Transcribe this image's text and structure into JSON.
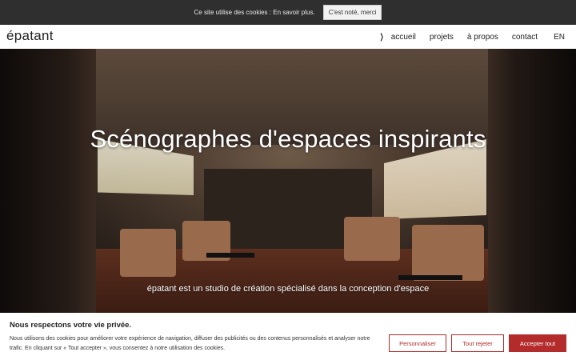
{
  "cookie_bar": {
    "text": "Ce site utilise des cookies : En savoir plus.",
    "button": "C'est noté, merci"
  },
  "header": {
    "logo": "épatant",
    "nav": [
      {
        "label": "accueil",
        "active": true
      },
      {
        "label": "projets"
      },
      {
        "label": "à propos"
      },
      {
        "label": "contact"
      },
      {
        "label": "EN"
      }
    ]
  },
  "hero": {
    "title": "Scénographes d'espaces inspirants",
    "subtitle": "épatant est un studio de création spécialisé dans la conception d'espace"
  },
  "consent": {
    "title": "Nous respectons votre vie privée.",
    "text": "Nous utilisons des cookies pour améliorer votre expérience de navigation, diffuser des publicités ou des contenus personnalisés et analyser notre trafic. En cliquant sur « Tout accepter », vous consentez à notre utilisation des cookies.",
    "buttons": {
      "customize": "Personnaliser",
      "reject": "Tout rejeter",
      "accept": "Accepter tout"
    }
  },
  "colors": {
    "accent": "#b32b2b",
    "cookie_bar_bg": "#2f2f2f"
  }
}
